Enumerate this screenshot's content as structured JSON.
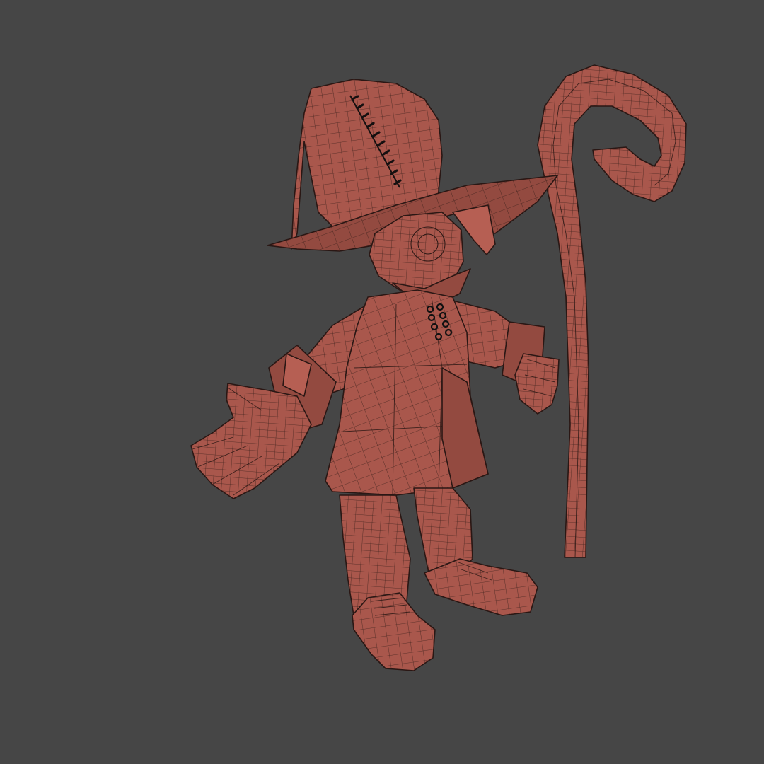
{
  "viewport": {
    "background": "#464646",
    "model_color": "#a9574c",
    "wire_color": "#2a1714"
  }
}
